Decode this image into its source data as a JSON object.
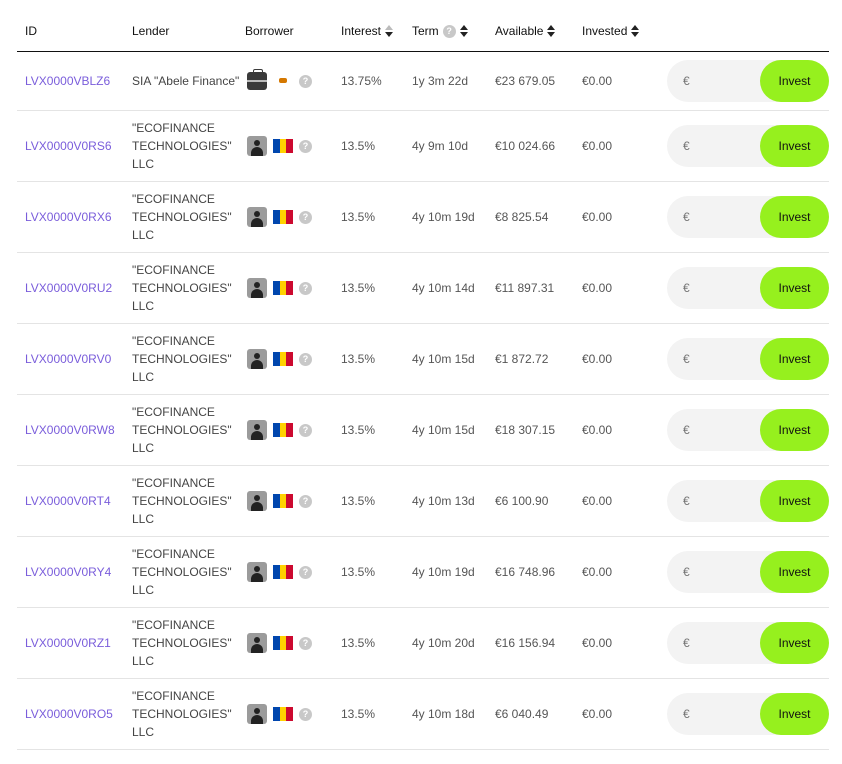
{
  "columns": {
    "id": "ID",
    "lender": "Lender",
    "borrower": "Borrower",
    "interest": "Interest",
    "term": "Term",
    "available": "Available",
    "invested": "Invested"
  },
  "currency_symbol": "€",
  "invest_label": "Invest",
  "help_glyph": "?",
  "accent_color": "#96f01e",
  "link_color": "#7a5ddb",
  "loans": [
    {
      "id": "LVX0000VBLZ6",
      "lender": "SIA \"Abele Finance\"",
      "borrower_icon": "briefcase-icon",
      "country": "cyprus",
      "interest": "13.75%",
      "term": "1y 3m 22d",
      "available": "€23 679.05",
      "invested": "€0.00"
    },
    {
      "id": "LVX0000V0RS6",
      "lender": "\"ECOFINANCE TECHNOLOGIES\" LLC",
      "borrower_icon": "person-icon",
      "country": "moldova",
      "interest": "13.5%",
      "term": "4y 9m 10d",
      "available": "€10 024.66",
      "invested": "€0.00"
    },
    {
      "id": "LVX0000V0RX6",
      "lender": "\"ECOFINANCE TECHNOLOGIES\" LLC",
      "borrower_icon": "person-icon",
      "country": "moldova",
      "interest": "13.5%",
      "term": "4y 10m 19d",
      "available": "€8 825.54",
      "invested": "€0.00"
    },
    {
      "id": "LVX0000V0RU2",
      "lender": "\"ECOFINANCE TECHNOLOGIES\" LLC",
      "borrower_icon": "person-icon",
      "country": "moldova",
      "interest": "13.5%",
      "term": "4y 10m 14d",
      "available": "€11 897.31",
      "invested": "€0.00"
    },
    {
      "id": "LVX0000V0RV0",
      "lender": "\"ECOFINANCE TECHNOLOGIES\" LLC",
      "borrower_icon": "person-icon",
      "country": "moldova",
      "interest": "13.5%",
      "term": "4y 10m 15d",
      "available": "€1 872.72",
      "invested": "€0.00"
    },
    {
      "id": "LVX0000V0RW8",
      "lender": "\"ECOFINANCE TECHNOLOGIES\" LLC",
      "borrower_icon": "person-icon",
      "country": "moldova",
      "interest": "13.5%",
      "term": "4y 10m 15d",
      "available": "€18 307.15",
      "invested": "€0.00"
    },
    {
      "id": "LVX0000V0RT4",
      "lender": "\"ECOFINANCE TECHNOLOGIES\" LLC",
      "borrower_icon": "person-icon",
      "country": "moldova",
      "interest": "13.5%",
      "term": "4y 10m 13d",
      "available": "€6 100.90",
      "invested": "€0.00"
    },
    {
      "id": "LVX0000V0RY4",
      "lender": "\"ECOFINANCE TECHNOLOGIES\" LLC",
      "borrower_icon": "person-icon",
      "country": "moldova",
      "interest": "13.5%",
      "term": "4y 10m 19d",
      "available": "€16 748.96",
      "invested": "€0.00"
    },
    {
      "id": "LVX0000V0RZ1",
      "lender": "\"ECOFINANCE TECHNOLOGIES\" LLC",
      "borrower_icon": "person-icon",
      "country": "moldova",
      "interest": "13.5%",
      "term": "4y 10m 20d",
      "available": "€16 156.94",
      "invested": "€0.00"
    },
    {
      "id": "LVX0000V0RO5",
      "lender": "\"ECOFINANCE TECHNOLOGIES\" LLC",
      "borrower_icon": "person-icon",
      "country": "moldova",
      "interest": "13.5%",
      "term": "4y 10m 18d",
      "available": "€6 040.49",
      "invested": "€0.00"
    }
  ]
}
